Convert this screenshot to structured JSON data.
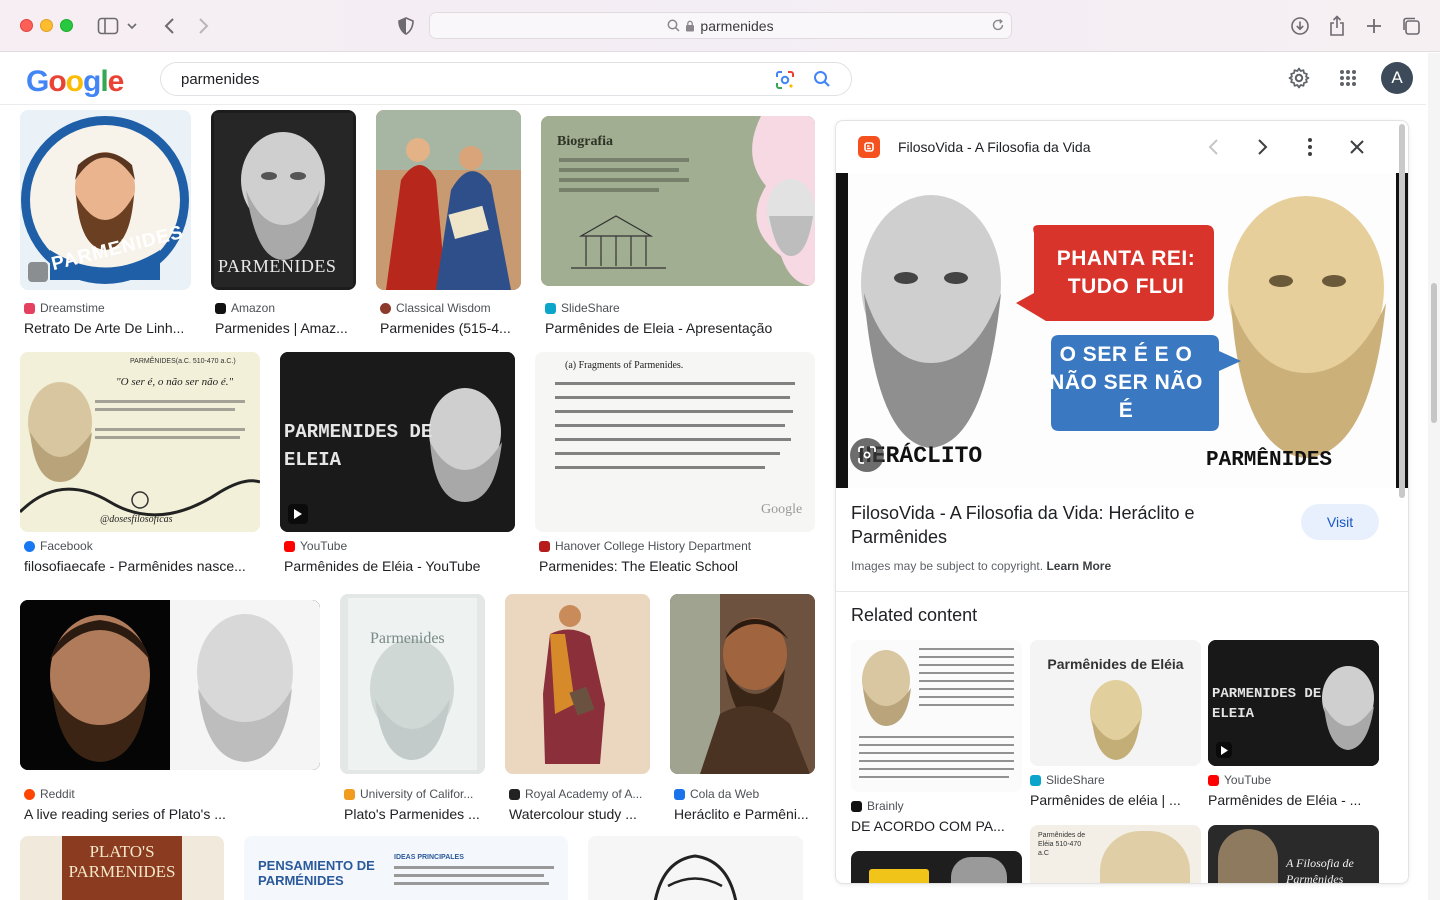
{
  "browser": {
    "url": "parmenides"
  },
  "google": {
    "logo": "Google",
    "query": "parmenides",
    "avatar_letter": "A"
  },
  "results": [
    {
      "source": "Dreamstime",
      "title": "Retrato De Arte De Linh...",
      "fav": "#e4405f"
    },
    {
      "source": "Amazon",
      "title": "Parmenides | Amaz...",
      "fav": "#111111"
    },
    {
      "source": "Classical Wisdom",
      "title": "Parmenides (515-4...",
      "fav": "#8b3a2b"
    },
    {
      "source": "SlideShare",
      "title": "Parmênides de Eleia - Apresentação",
      "fav": "#0aa5c9"
    },
    {
      "source": "Facebook",
      "title": "filosofiaecafe - Parmênides nasce...",
      "fav": "#1877f2"
    },
    {
      "source": "YouTube",
      "title": "Parmênides de Eléia - YouTube",
      "fav": "#ff0000"
    },
    {
      "source": "Hanover College History Department",
      "title": "Parmenides: The Eleatic School",
      "fav": "#b71c1c"
    },
    {
      "source": "Reddit",
      "title": "A live reading series of Plato's ...",
      "fav": "#ff4500"
    },
    {
      "source": "University of Califor...",
      "title": "Plato's Parmenides ...",
      "fav": "#f29c1f"
    },
    {
      "source": "Royal Academy of A...",
      "title": "Watercolour study ...",
      "fav": "#222222"
    },
    {
      "source": "Cola da Web",
      "title": "Heráclito e Parmêni...",
      "fav": "#1a73e8"
    }
  ],
  "thumb_text": {
    "r1c1": "PARMENIDES",
    "r1c2": "PARMENIDES",
    "r1c4_heading": "Biografia",
    "r2c1_heading": "PARMÊNIDES(a.C. 510-470 a.C.)",
    "r2c1_quote": "\"O ser é, o não ser não é.\"",
    "r2c1_handle": "@dosesfilosoficas",
    "r2c2": "PARMENIDES DE ELEIA",
    "r2c3_heading": "(a) Fragments of Parmenides.",
    "r2c3_brand": "Google",
    "r3c2": "Parmenides",
    "r4c1": "PLATO'S PARMENIDES",
    "r4c2_heading": "PENSAMIENTO DE PARMÉNIDES",
    "r4c2_sub": "IDEAS PRINCIPALES"
  },
  "panel": {
    "site": "FilosoVida - A Filosofia da Vida",
    "image_bubble_1": "PHANTA REI: TUDO FLUI",
    "image_bubble_2": "O SER É E O NÃO SER NÃO É",
    "image_label_left": "HERÁCLITO",
    "image_label_right": "PARMÊNIDES",
    "title": "FilosoVida - A Filosofia da Vida: Heráclito e Parmênides",
    "visit_label": "Visit",
    "copyright": "Images may be subject to copyright.",
    "learn_more": "Learn More",
    "related_heading": "Related content",
    "related": [
      {
        "source": "Brainly",
        "title": "DE ACORDO COM PA...",
        "fav": "#111111"
      },
      {
        "source": "SlideShare",
        "title": "Parmênides de eléia | ...",
        "fav": "#0aa5c9",
        "thumb_text": "Parmênides de Eléia"
      },
      {
        "source": "YouTube",
        "title": "Parmênides de Eléia - ...",
        "fav": "#ff0000",
        "thumb_text": "PARMENIDES DE ELEIA"
      }
    ],
    "related_more_1": "Parmênides de Eléia 510-470 a.C",
    "related_more_2": "A Filosofia de Parmênides"
  },
  "colors": {
    "accent": "#1a73e8",
    "visit_bg": "#e8f0fe"
  }
}
